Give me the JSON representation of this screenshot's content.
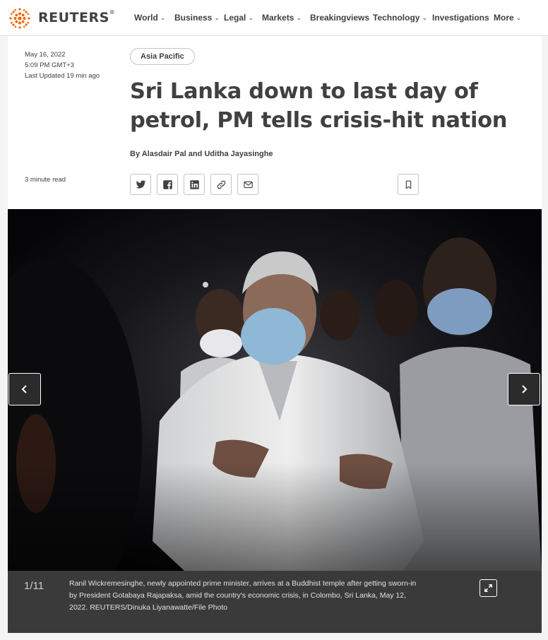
{
  "header": {
    "brand": "REUTERS",
    "brand_mark": "®",
    "nav": [
      {
        "label": "World",
        "dropdown": true
      },
      {
        "label": "Business",
        "dropdown": true
      },
      {
        "label": "Legal",
        "dropdown": true
      },
      {
        "label": "Markets",
        "dropdown": true
      },
      {
        "label": "Breakingviews",
        "dropdown": false
      },
      {
        "label": "Technology",
        "dropdown": true
      },
      {
        "label": "Investigations",
        "dropdown": false
      },
      {
        "label": "More",
        "dropdown": true
      }
    ]
  },
  "article": {
    "date": "May 16, 2022",
    "time": "5:09 PM GMT+3",
    "updated": "Last Updated 19 min ago",
    "section": "Asia Pacific",
    "headline": "Sri Lanka down to last day of petrol, PM tells crisis-hit nation",
    "byline": "By Alasdair Pal and Uditha Jayasinghe",
    "read_time": "3 minute read",
    "share_icons": [
      "twitter-icon",
      "facebook-icon",
      "linkedin-icon",
      "link-icon",
      "email-icon"
    ],
    "bookmark_icon": "bookmark-icon"
  },
  "gallery": {
    "counter": "1/11",
    "caption": "Ranil Wickremesinghe, newly appointed prime minister, arrives at a Buddhist temple after getting sworn-in by President Gotabaya Rajapaksa, amid the country's economic crisis, in Colombo, Sri Lanka, May 12, 2022. REUTERS/Dinuka Liyanawatte/File Photo",
    "prev_icon": "chevron-left-icon",
    "next_icon": "chevron-right-icon",
    "expand_icon": "expand-icon"
  },
  "colors": {
    "logo_orange": "#fa6400",
    "text": "#404040",
    "caption_bg": "#3a3a3a"
  }
}
